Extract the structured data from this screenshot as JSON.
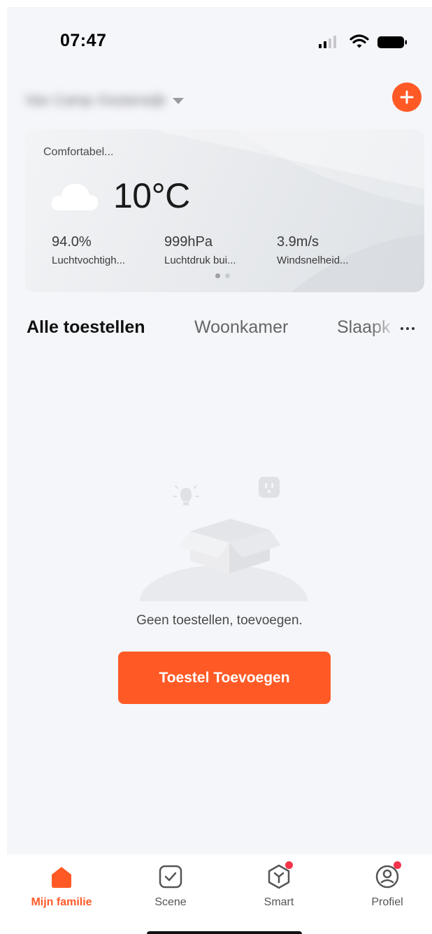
{
  "status_bar": {
    "time": "07:47"
  },
  "header": {
    "home_name": "Van Camp Oosterwijk"
  },
  "weather": {
    "summary": "Comfortabel...",
    "temperature": "10°C",
    "metrics": [
      {
        "value": "94.0%",
        "label": "Luchtvochtigh..."
      },
      {
        "value": "999hPa",
        "label": "Luchtdruk bui..."
      },
      {
        "value": "3.9m/s",
        "label": "Windsnelheid..."
      }
    ],
    "pages": 2,
    "active_page": 1
  },
  "tabs": [
    {
      "label": "Alle toestellen",
      "active": true
    },
    {
      "label": "Woonkamer",
      "active": false
    },
    {
      "label": "Slaapkamer",
      "active": false
    }
  ],
  "empty_state": {
    "message": "Geen toestellen, toevoegen.",
    "button_label": "Toestel Toevoegen"
  },
  "bottom_nav": [
    {
      "label": "Mijn familie",
      "icon": "home-icon",
      "active": true,
      "badge": false
    },
    {
      "label": "Scene",
      "icon": "scene-checkbox-icon",
      "active": false,
      "badge": false
    },
    {
      "label": "Smart",
      "icon": "smart-cube-icon",
      "active": false,
      "badge": true
    },
    {
      "label": "Profiel",
      "icon": "profile-icon",
      "active": false,
      "badge": true
    }
  ],
  "colors": {
    "accent": "#ff5a26",
    "badge": "#f2334a",
    "background": "#f5f6fa"
  }
}
